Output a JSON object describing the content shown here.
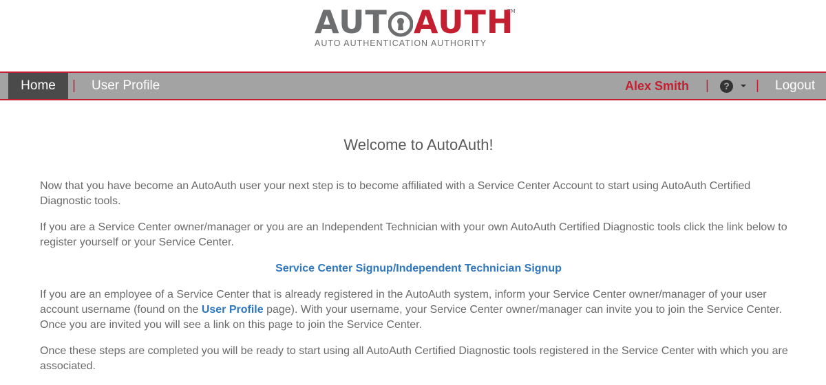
{
  "logo": {
    "part_auto": "AUTO",
    "part_auth": "AUTH",
    "tm": "TM",
    "tagline": "AUTO AUTHENTICATION AUTHORITY"
  },
  "nav": {
    "home": "Home",
    "sep": "|",
    "user_profile": "User Profile",
    "user_name": "Alex Smith",
    "help_glyph": "?",
    "logout": "Logout"
  },
  "content": {
    "welcome": "Welcome to AutoAuth!",
    "p1": "Now that you have become an AutoAuth user your next step is to become affiliated with a Service Center Account to start using AutoAuth Certified Diagnostic tools.",
    "p2": "If you are a Service Center owner/manager or you are an Independent Technician with your own AutoAuth Certified Diagnostic tools click the link below to register yourself or your Service Center.",
    "signup_link": "Service Center Signup/Independent Technician Signup",
    "p3_before": "If you are an employee of a Service Center that is already registered in the AutoAuth system, inform your Service Center owner/manager of your user account username (found on the ",
    "p3_link": "User Profile",
    "p3_after": " page). With your username, your Service Center owner/manager can invite you to join the Service Center. Once you are invited you will see a link on this page to join the Service Center.",
    "p4": "Once these steps are completed you will be ready to start using all AutoAuth Certified Diagnostic tools registered in the Service Center with which you are associated."
  },
  "colors": {
    "brand_red": "#c41f30",
    "brand_gray": "#6d6e70",
    "navbar_bg": "#a3a3a3",
    "link_blue": "#2f76bd"
  },
  "icons": {
    "logo_keyhole": "keyhole-o-icon",
    "help": "question-circle-icon",
    "dropdown": "caret-down-icon"
  }
}
